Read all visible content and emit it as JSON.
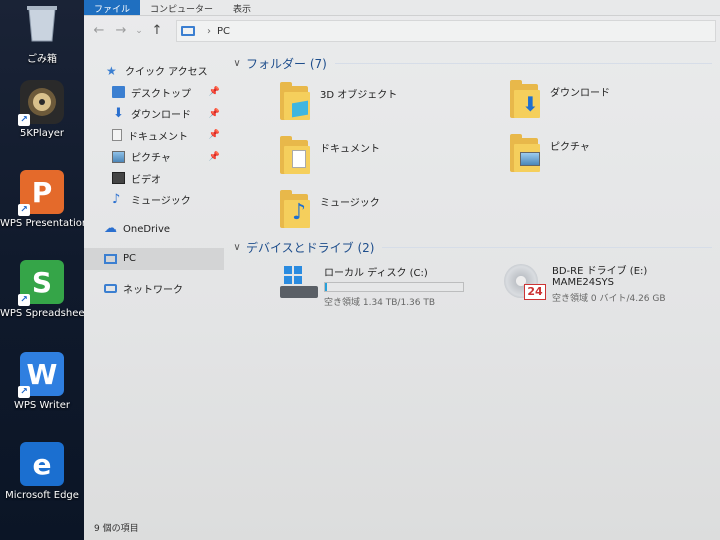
{
  "desktop": {
    "icons": [
      {
        "label": "ごみ箱",
        "icon": "recycle-bin-icon"
      },
      {
        "label": "5KPlayer",
        "icon": "5kplayer-icon"
      },
      {
        "label": "WPS Presentation",
        "icon": "wps-presentation-icon",
        "glyph": "P",
        "color": "#e46a2b"
      },
      {
        "label": "WPS Spreadsheets",
        "icon": "wps-spreadsheets-icon",
        "glyph": "S",
        "color": "#35a548"
      },
      {
        "label": "WPS Writer",
        "icon": "wps-writer-icon",
        "glyph": "W",
        "color": "#2f7fe0"
      },
      {
        "label": "Microsoft Edge",
        "icon": "edge-icon",
        "glyph": "e",
        "color": "#1b6fd0"
      }
    ]
  },
  "ribbon": {
    "tabs": [
      "ファイル",
      "コンピューター",
      "表示"
    ]
  },
  "address": {
    "crumb": "PC"
  },
  "nav": {
    "quick_access": "クイック アクセス",
    "quick_items": [
      "デスクトップ",
      "ダウンロード",
      "ドキュメント",
      "ピクチャ",
      "ビデオ",
      "ミュージック"
    ],
    "onedrive": "OneDrive",
    "pc": "PC",
    "network": "ネットワーク"
  },
  "content": {
    "folders_header": "フォルダー (7)",
    "folders": [
      "3D オブジェクト",
      "ダウンロード",
      "ドキュメント",
      "ピクチャ",
      "ミュージック"
    ],
    "devices_header": "デバイスとドライブ (2)",
    "drives": [
      {
        "name": "ローカル ディスク (C:)",
        "free": "空き領域 1.34 TB/1.36 TB",
        "used_fraction": 0.015
      },
      {
        "name": "BD-RE ドライブ (E:)",
        "label": "MAME24SYS",
        "free": "空き領域 0 バイト/4.26 GB"
      }
    ]
  },
  "status": "9 個の項目",
  "colors": {
    "accent": "#1f6fc0",
    "folder": "#f5cf5c",
    "bar": "#26a0da"
  }
}
